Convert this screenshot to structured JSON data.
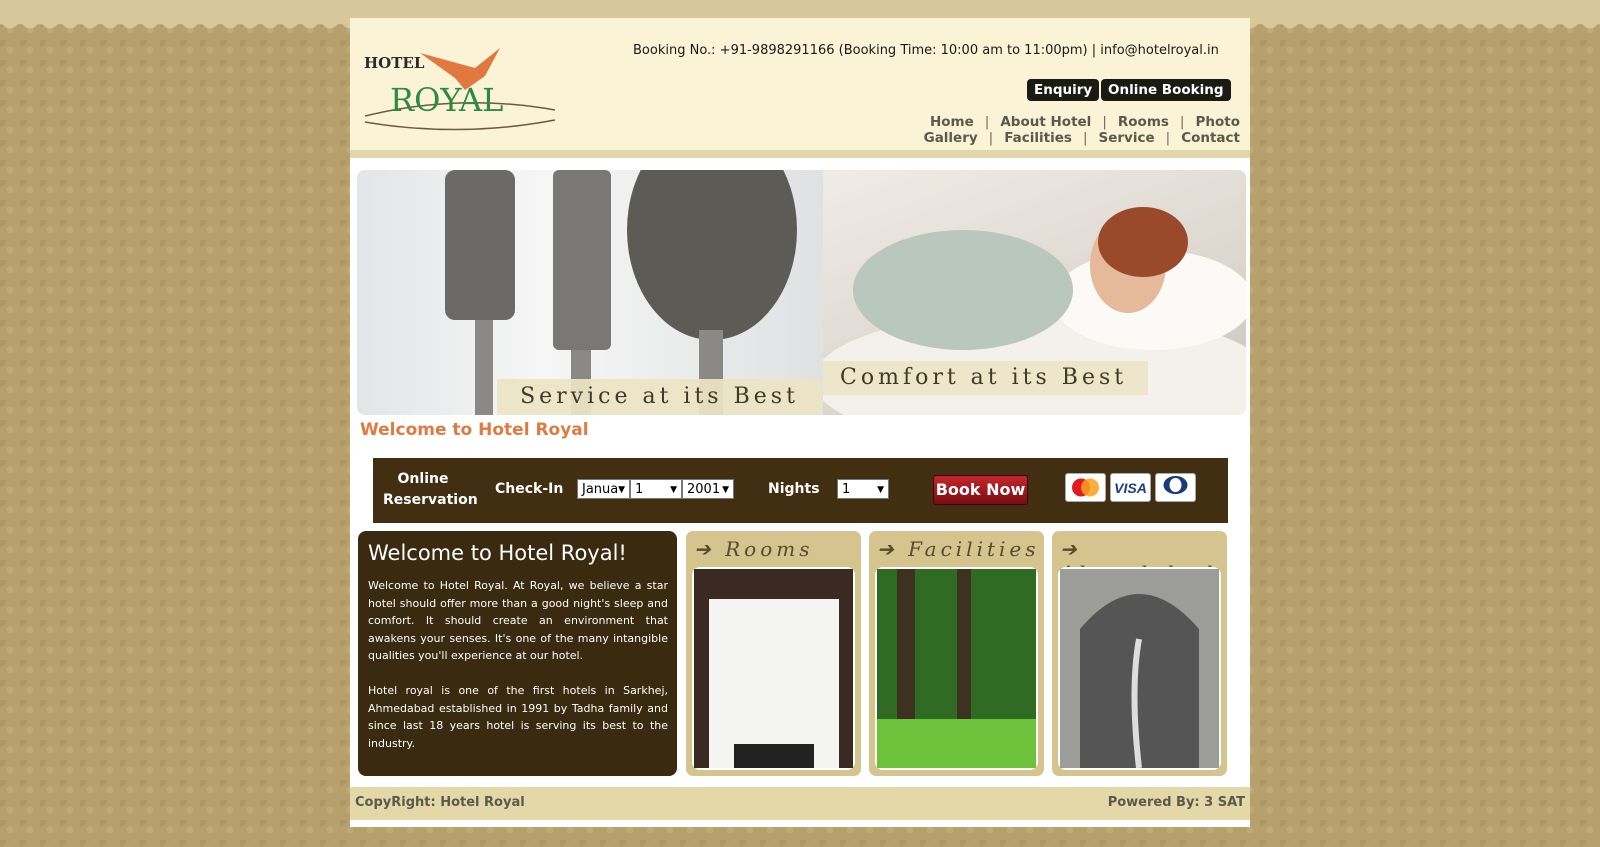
{
  "header": {
    "booking_info": "Booking No.: +91-9898291166 (Booking Time: 10:00 am to 11:00pm) | info@hotelroyal.in",
    "logo_small": "HOTEL",
    "logo_big": "ROYAL",
    "enquiry_label": "Enquiry",
    "online_booking_label": "Online Booking"
  },
  "nav": {
    "items": [
      "Home",
      "About Hotel",
      "Rooms",
      "Photo Gallery",
      "Facilities",
      "Service",
      "Contact"
    ]
  },
  "banner": {
    "caption_left": "Service at its Best",
    "caption_right": "Comfort at its Best"
  },
  "welcome_heading": "Welcome to Hotel Royal",
  "reservation": {
    "label_line1": "Online",
    "label_line2": "Reservation",
    "checkin_label": "Check-In",
    "month_value": "Janua",
    "day_value": "1",
    "year_value": "2001",
    "nights_label": "Nights",
    "nights_value": "1",
    "book_label": "Book Now",
    "cards": [
      "MasterCard",
      "VISA",
      "Diners Club"
    ]
  },
  "intro": {
    "title": "Welcome to Hotel Royal!",
    "para1": "Welcome to Hotel Royal. At Royal, we believe a star hotel should offer more than a good night's sleep and comfort. It should create an environment that awakens your senses. It's one of the many intangible qualities you'll experience at our hotel.",
    "para2": "Hotel royal is one of the first hotels in Sarkhej, Ahmedabad established in 1991 by Tadha family and since last 18 years hotel is serving its best to the industry."
  },
  "panels": {
    "rooms": "Rooms",
    "facilities": "Facilities",
    "ahmedabad": "Ahmedabad"
  },
  "footer": {
    "copyright": "CopyRight: Hotel Royal",
    "powered": "Powered By: 3 SAT"
  },
  "colors": {
    "accent": "#e27a40",
    "brown": "#3a2a10",
    "cream": "#faf3d5"
  }
}
